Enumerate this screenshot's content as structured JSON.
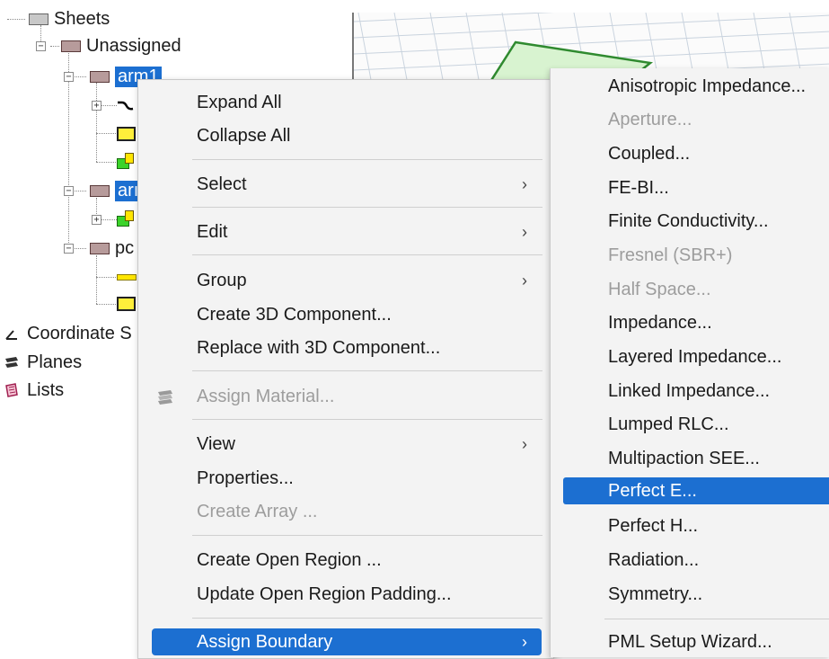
{
  "tree": {
    "sheets": "Sheets",
    "unassigned": "Unassigned",
    "arm1": "arm1",
    "arm2_partial": "arı",
    "pc_partial": "pc",
    "coordinate_systems_partial": "Coordinate S",
    "planes": "Planes",
    "lists": "Lists",
    "expanded_glyph": "−",
    "collapsed_glyph": "+"
  },
  "context_menu": {
    "items": [
      {
        "label": "Expand All"
      },
      {
        "label": "Collapse All"
      },
      {
        "label": "Select",
        "submenu": true
      },
      {
        "label": "Edit",
        "submenu": true
      },
      {
        "label": "Group",
        "submenu": true
      },
      {
        "label": "Create 3D Component..."
      },
      {
        "label": "Replace with 3D Component..."
      },
      {
        "label": "Assign Material...",
        "disabled": true,
        "icon": "material-icon"
      },
      {
        "label": "View",
        "submenu": true
      },
      {
        "label": "Properties..."
      },
      {
        "label": "Create Array ...",
        "disabled": true
      },
      {
        "label": "Create Open Region ..."
      },
      {
        "label": "Update Open Region Padding..."
      },
      {
        "label": "Assign Boundary",
        "submenu": true,
        "highlighted": true
      }
    ],
    "arrow_glyph": "›"
  },
  "boundary_submenu": {
    "items": [
      {
        "label": "Anisotropic Impedance..."
      },
      {
        "label": "Aperture...",
        "disabled": true
      },
      {
        "label": "Coupled..."
      },
      {
        "label": "FE-BI..."
      },
      {
        "label": "Finite Conductivity..."
      },
      {
        "label": "Fresnel (SBR+)",
        "disabled": true
      },
      {
        "label": "Half Space...",
        "disabled": true
      },
      {
        "label": "Impedance..."
      },
      {
        "label": "Layered Impedance..."
      },
      {
        "label": "Linked Impedance..."
      },
      {
        "label": "Lumped RLC..."
      },
      {
        "label": "Multipaction SEE..."
      },
      {
        "label": "Perfect E...",
        "highlighted": true
      },
      {
        "label": "Perfect H..."
      },
      {
        "label": "Radiation..."
      },
      {
        "label": "Symmetry..."
      },
      {
        "label": "PML Setup Wizard..."
      }
    ]
  },
  "colors": {
    "highlight": "#1c6fd1",
    "menu_bg": "#f3f3f3",
    "disabled_text": "#9d9d9d",
    "port_green": "#3bd32a",
    "face_yellow": "#ffef3b"
  }
}
